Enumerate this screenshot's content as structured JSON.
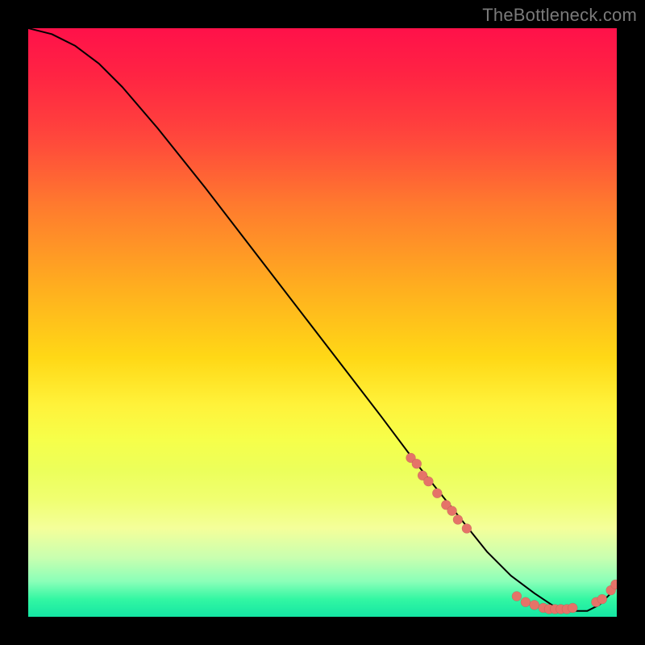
{
  "watermark": "TheBottleneck.com",
  "chart_data": {
    "type": "line",
    "title": "",
    "xlabel": "",
    "ylabel": "",
    "xlim": [
      0,
      100
    ],
    "ylim": [
      0,
      100
    ],
    "grid": false,
    "legend": false,
    "curve": {
      "x": [
        0,
        4,
        8,
        12,
        16,
        22,
        30,
        40,
        50,
        60,
        66,
        70,
        74,
        78,
        82,
        86,
        89,
        92,
        95,
        97,
        99,
        100
      ],
      "y": [
        100,
        99,
        97,
        94,
        90,
        83,
        73,
        60,
        47,
        34,
        26,
        21,
        16,
        11,
        7,
        4,
        2,
        1,
        1,
        2,
        4,
        5
      ]
    },
    "markers": [
      {
        "x": 65,
        "y": 27
      },
      {
        "x": 66,
        "y": 26
      },
      {
        "x": 67,
        "y": 24
      },
      {
        "x": 68,
        "y": 23
      },
      {
        "x": 69.5,
        "y": 21
      },
      {
        "x": 71,
        "y": 19
      },
      {
        "x": 72,
        "y": 18
      },
      {
        "x": 73,
        "y": 16.5
      },
      {
        "x": 74.5,
        "y": 15
      },
      {
        "x": 83,
        "y": 3.5
      },
      {
        "x": 84.5,
        "y": 2.5
      },
      {
        "x": 86,
        "y": 2
      },
      {
        "x": 87.5,
        "y": 1.5
      },
      {
        "x": 88.5,
        "y": 1.3
      },
      {
        "x": 89.5,
        "y": 1.3
      },
      {
        "x": 90.5,
        "y": 1.3
      },
      {
        "x": 91.5,
        "y": 1.3
      },
      {
        "x": 92.5,
        "y": 1.5
      },
      {
        "x": 96.5,
        "y": 2.5
      },
      {
        "x": 97.5,
        "y": 3
      },
      {
        "x": 99,
        "y": 4.5
      },
      {
        "x": 99.8,
        "y": 5.5
      }
    ]
  }
}
